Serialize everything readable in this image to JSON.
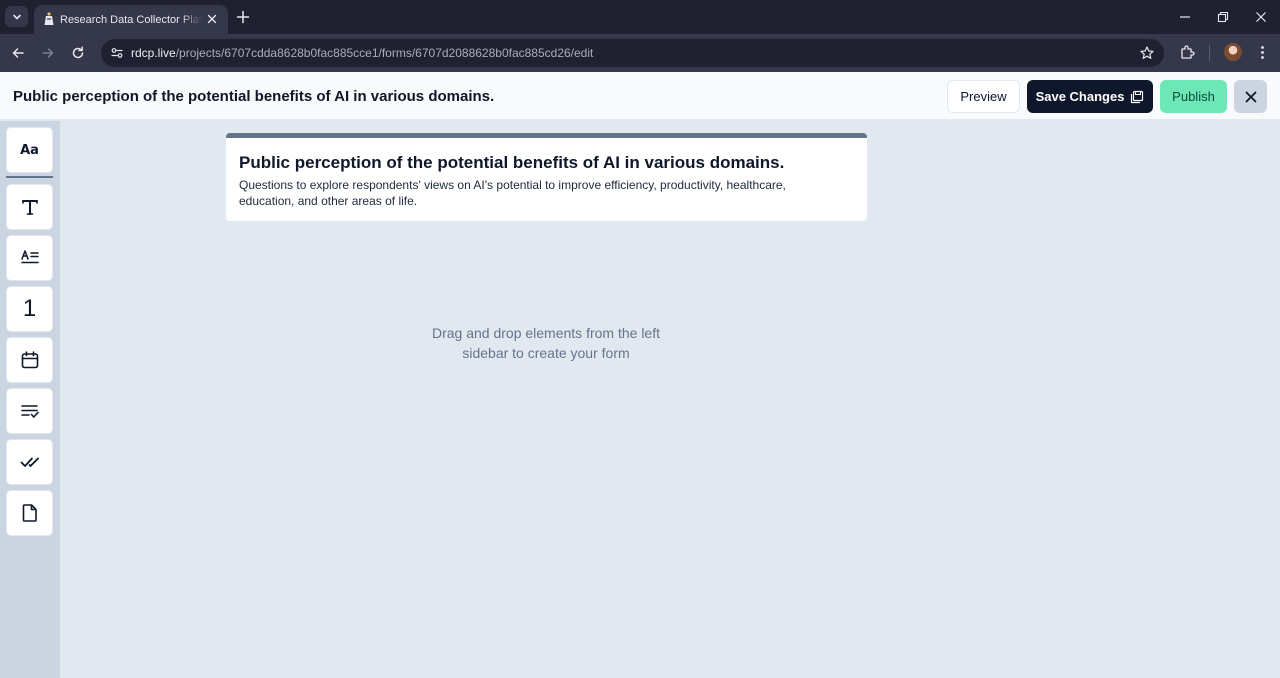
{
  "browser": {
    "tab_title": "Research Data Collector Platform",
    "url_host": "rdcp.live",
    "url_path": "/projects/6707cdda8628b0fac885cce1/forms/6707d2088628b0fac885cd26/edit"
  },
  "header": {
    "form_name": "Public perception of the potential benefits of AI in various domains.",
    "preview_label": "Preview",
    "save_label": "Save Changes",
    "publish_label": "Publish"
  },
  "sidebar": {
    "tools": [
      {
        "label": "Aa",
        "icon": "text-style-icon"
      },
      {
        "icon": "title-icon"
      },
      {
        "icon": "paragraph-icon"
      },
      {
        "label": "1",
        "icon": "number-icon"
      },
      {
        "icon": "calendar-icon"
      },
      {
        "icon": "select-list-icon"
      },
      {
        "icon": "checkbox-icon"
      },
      {
        "icon": "file-icon"
      }
    ]
  },
  "form": {
    "title": "Public perception of the potential benefits of AI in various domains.",
    "description": "Questions to explore respondents' views on AI's potential to improve efficiency, productivity, healthcare, education, and other areas of life.",
    "empty_hint": "Drag and drop elements from the left sidebar to create your form"
  },
  "colors": {
    "primary": "#0f172a",
    "publish": "#6ee7b7",
    "canvas": "#e2e8f0",
    "sidebar": "#cbd5e1"
  }
}
